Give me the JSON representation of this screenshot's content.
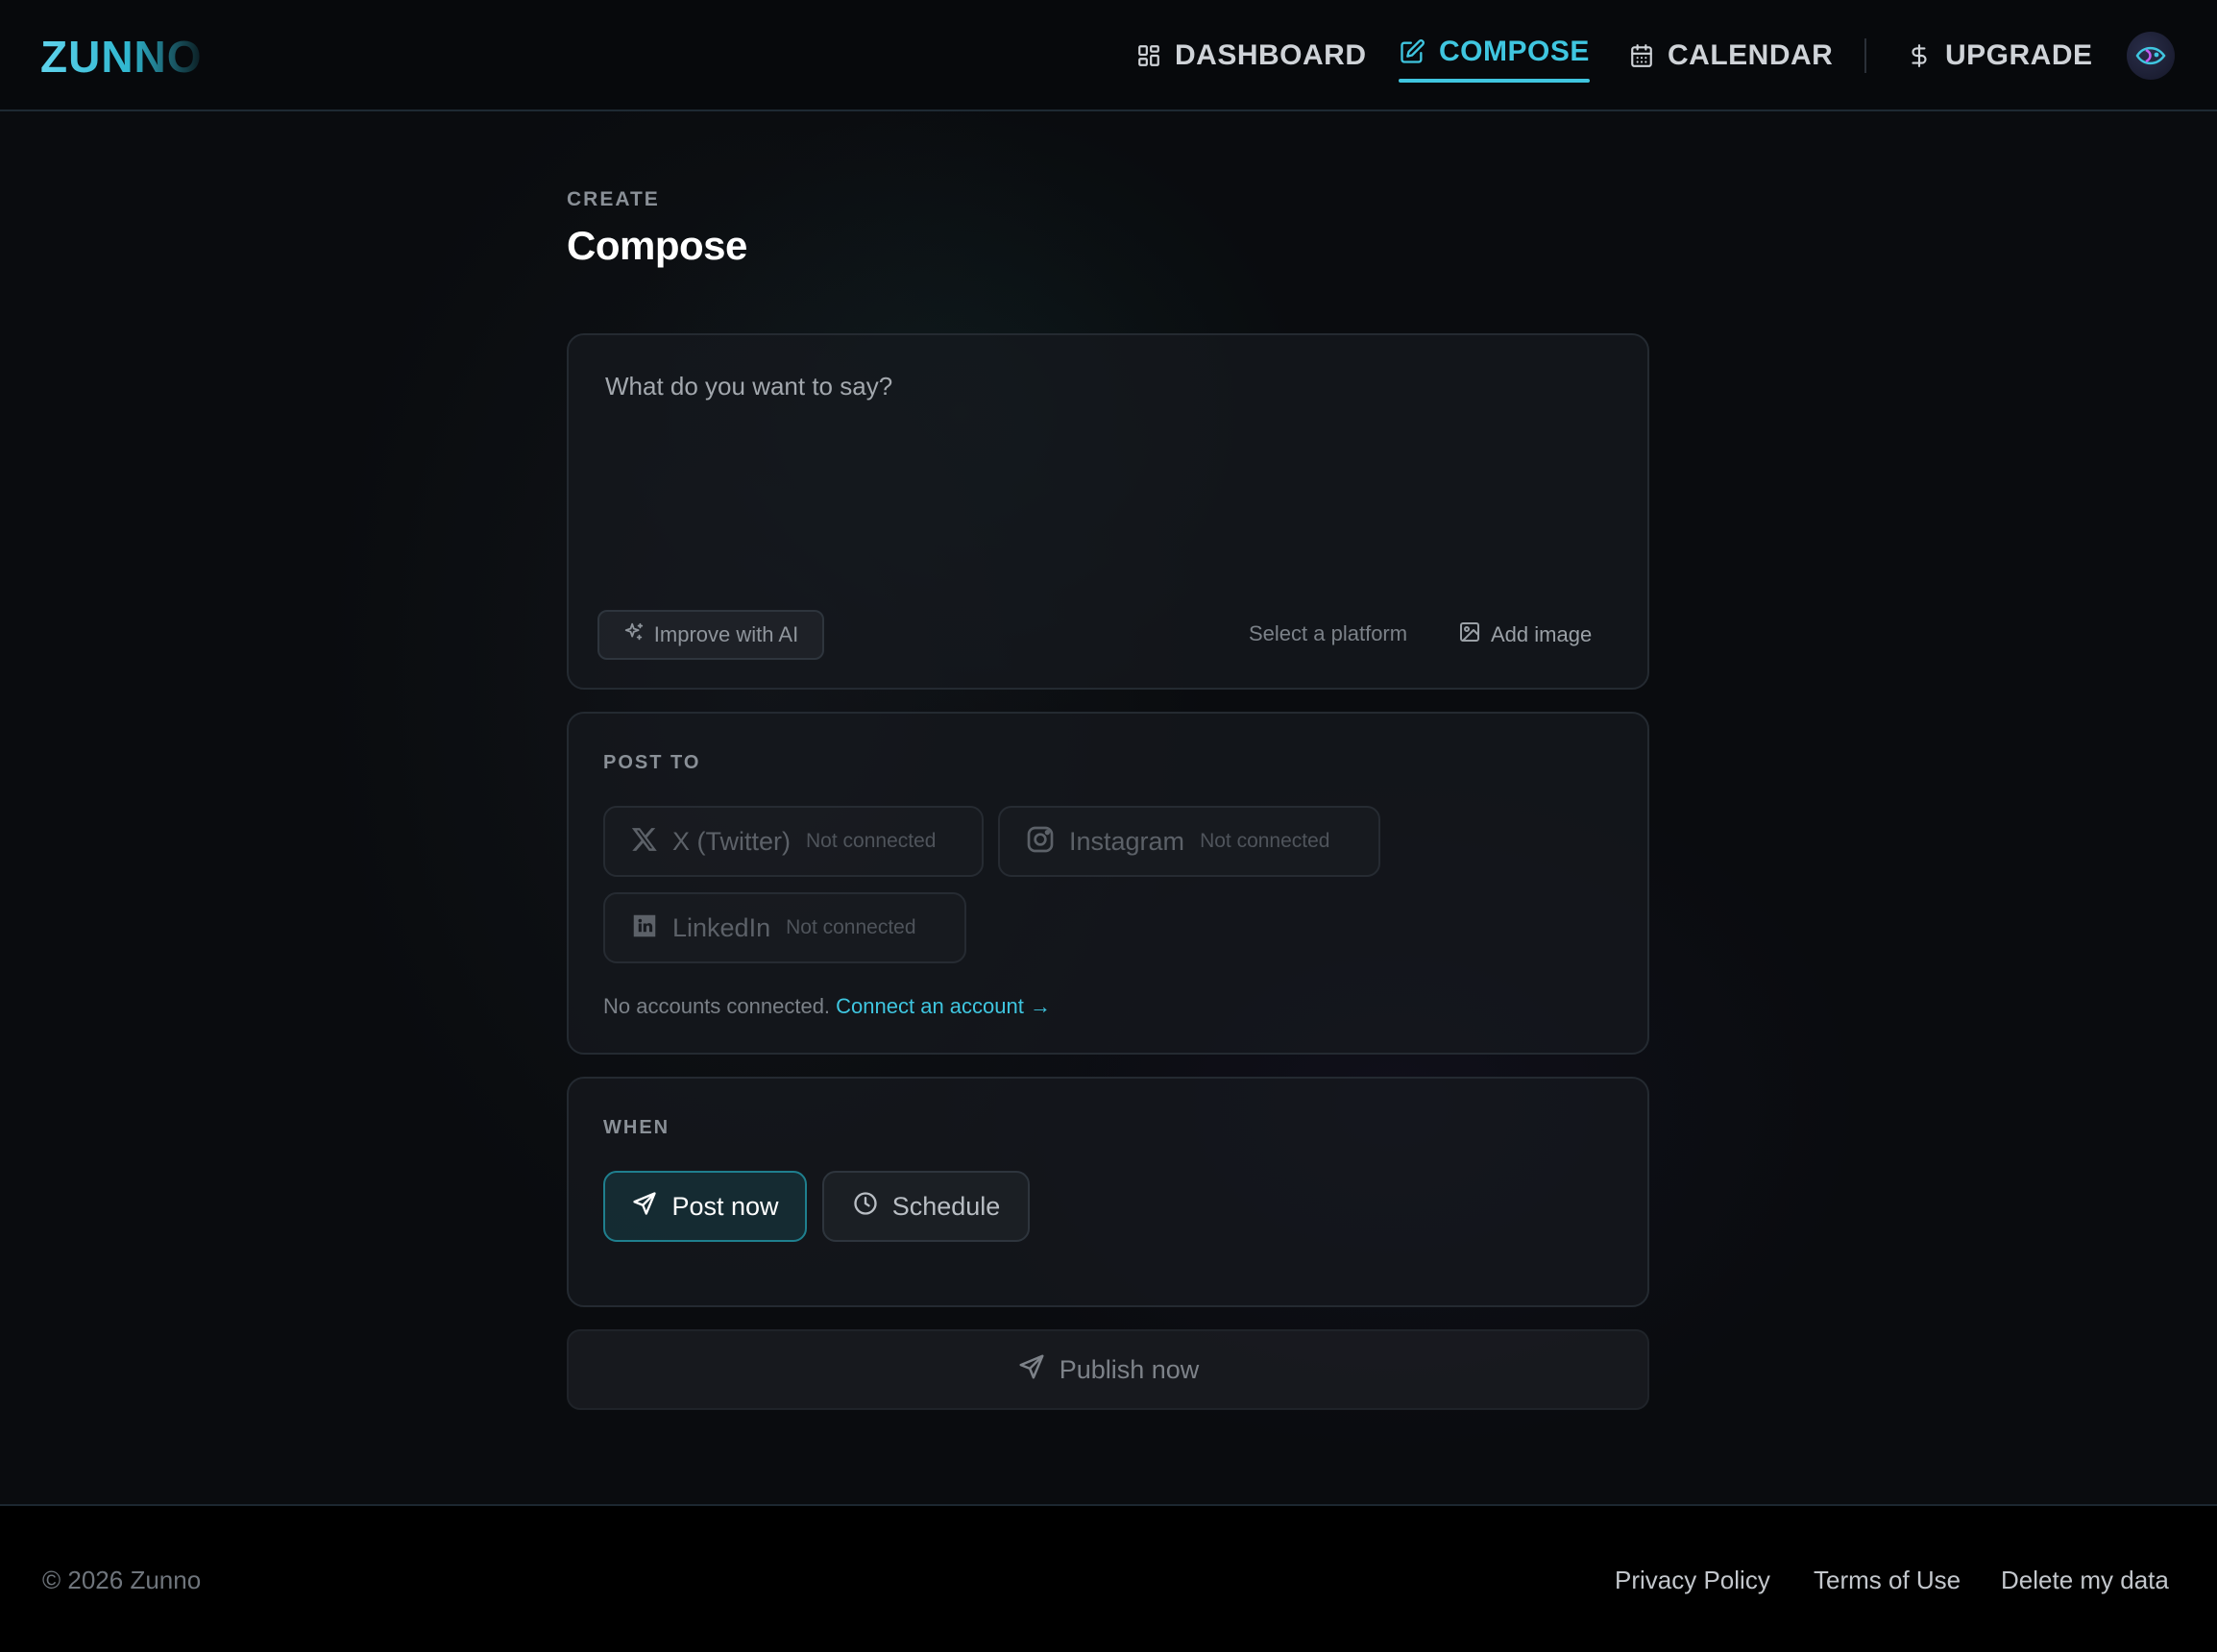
{
  "app": {
    "logo": "ZUNNO"
  },
  "nav": {
    "items": [
      {
        "label": "DASHBOARD",
        "icon": "grid-icon"
      },
      {
        "label": "COMPOSE",
        "icon": "edit-icon",
        "active": true
      },
      {
        "label": "CALENDAR",
        "icon": "calendar-icon"
      },
      {
        "label": "UPGRADE",
        "icon": "dollar-icon"
      }
    ]
  },
  "page": {
    "section": "CREATE",
    "title": "Compose"
  },
  "compose": {
    "placeholder": "What do you want to say?",
    "value": "",
    "improve_label": "Improve with AI",
    "platform_hint": "Select a platform",
    "add_image_label": "Add image"
  },
  "post_to": {
    "label": "POST TO",
    "platforms": [
      {
        "name": "X (Twitter)",
        "status": "Not connected",
        "icon": "x-twitter-icon"
      },
      {
        "name": "Instagram",
        "status": "Not connected",
        "icon": "instagram-icon"
      },
      {
        "name": "LinkedIn",
        "status": "Not connected",
        "icon": "linkedin-icon"
      }
    ],
    "no_accounts_text": "No accounts connected.",
    "connect_link": "Connect an account →"
  },
  "when": {
    "label": "WHEN",
    "post_now_label": "Post now",
    "schedule_label": "Schedule",
    "selected": "Post now"
  },
  "publish": {
    "label": "Publish now"
  },
  "footer": {
    "copyright": "© 2026 Zunno",
    "links": [
      "Privacy Policy",
      "Terms of Use",
      "Delete my data"
    ]
  },
  "colors": {
    "accent": "#3fc6e0",
    "background": "#0a0c0f",
    "card": "#16191e"
  }
}
